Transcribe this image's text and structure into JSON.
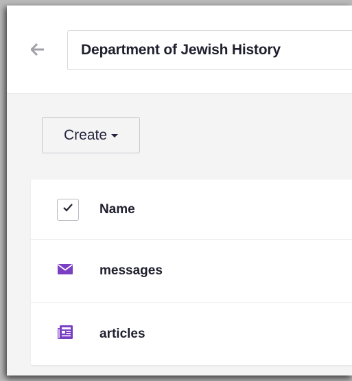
{
  "header": {
    "title": "Department of Jewish History"
  },
  "toolbar": {
    "create_label": "Create"
  },
  "list": {
    "column_name": "Name",
    "items": [
      {
        "label": "messages",
        "icon": "envelope-icon"
      },
      {
        "label": "articles",
        "icon": "newspaper-icon"
      }
    ]
  },
  "colors": {
    "accent": "#7b3fc4",
    "text": "#1f1f2e",
    "back_arrow": "#a0a0a8"
  }
}
